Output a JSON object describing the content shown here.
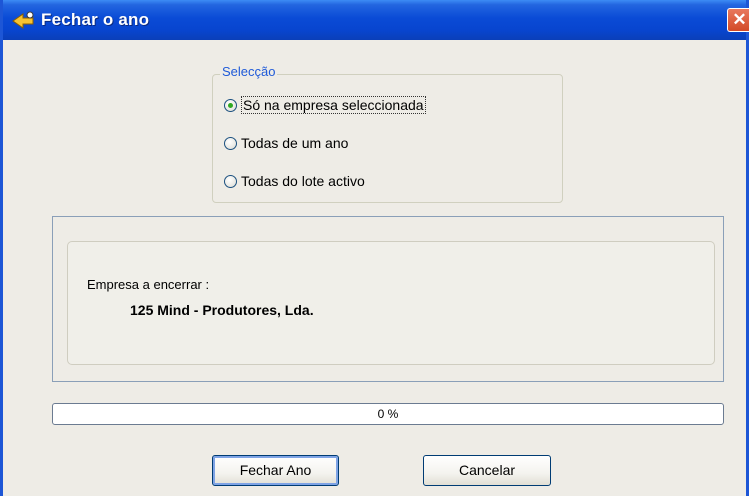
{
  "window": {
    "title": "Fechar o ano",
    "close_glyph": "✕",
    "title_icon": "app-icon"
  },
  "selection": {
    "legend": "Selecção",
    "options": [
      {
        "label": "Só na empresa seleccionada",
        "checked": true
      },
      {
        "label": "Todas de um ano",
        "checked": false
      },
      {
        "label": "Todas do lote activo",
        "checked": false
      }
    ]
  },
  "info": {
    "label": "Empresa a encerrar :",
    "company": "125 Mind - Produtores, Lda."
  },
  "progress": {
    "value": 0,
    "text": "0 %"
  },
  "buttons": {
    "ok": "Fechar Ano",
    "cancel": "Cancelar"
  },
  "colors": {
    "titlebar": "#0a4bd6",
    "accent": "#1f5ad8",
    "radio_dot": "#2fa821"
  }
}
